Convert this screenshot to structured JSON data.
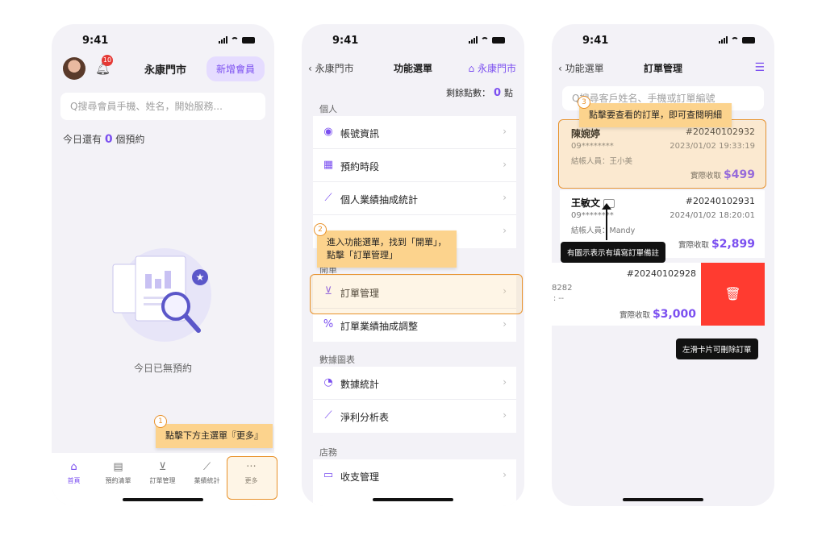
{
  "status": {
    "time": "9:41"
  },
  "screen1": {
    "avatar_icon": "user-avatar",
    "bell_icon": "bell-icon",
    "notification_count": "10",
    "store_name": "永康門市",
    "add_member_label": "新增會員",
    "search_placeholder": "Q搜尋會員手機、姓名，開始服務...",
    "today_prefix": "今日還有",
    "today_count": "0",
    "today_suffix": "個預約",
    "empty_text": "今日已無預約",
    "tabs": [
      {
        "label": "首頁",
        "icon": "home-icon"
      },
      {
        "label": "預約清單",
        "icon": "calendar-icon"
      },
      {
        "label": "訂單管理",
        "icon": "basket-icon"
      },
      {
        "label": "業績統計",
        "icon": "chart-icon"
      },
      {
        "label": "更多",
        "icon": "more-icon",
        "glyph": "···"
      }
    ],
    "callout_num": "1",
    "callout": "點擊下方主選單『更多』"
  },
  "screen2": {
    "back_label": "永康門市",
    "title": "功能選單",
    "right_label": "永康門市",
    "points_label": "剩餘點數：",
    "points_value": "0",
    "points_unit": "點",
    "section_personal": "個人",
    "item_account": "帳號資訊",
    "item_booking": "預約時段",
    "item_stats": "個人業績抽成統計",
    "section_order": "開單",
    "item_orders": "訂單管理",
    "item_commission": "訂單業績抽成調整",
    "section_data": "數據圖表",
    "item_data_stats": "數據統計",
    "item_profit": "淨利分析表",
    "section_store": "店務",
    "item_cashflow": "收支管理",
    "callout_num": "2",
    "callout_line1": "進入功能選單，找到「開單」，",
    "callout_line2": "點擊「訂單管理」"
  },
  "screen3": {
    "back_label": "功能選單",
    "title": "訂單管理",
    "search_placeholder": "Q搜尋客戶姓名、手機或訂單編號",
    "orders": [
      {
        "name": "陳婉婷",
        "no": "#20240102932",
        "phone": "09********",
        "date": "2023/01/02 19:33:19",
        "staff": "結帳人員：王小美",
        "amount_label": "實際收取",
        "amount": "$499"
      },
      {
        "name": "王敏文",
        "no": "#20240102931",
        "phone": "09********",
        "date": "2024/01/02 18:20:01",
        "staff": "結帳人員：Mandy",
        "amount_label": "實際收取",
        "amount": "$2,899"
      },
      {
        "name": "",
        "no": "#20240102928",
        "phone": "8282",
        "date": "",
        "staff": ": --",
        "amount_label": "實際收取",
        "amount": "$3,000"
      }
    ],
    "callout_num": "3",
    "callout": "點擊要查看的訂單，即可查閱明細",
    "tip_note": "有圖示表示有填寫訂單備註",
    "tip_delete": "左滑卡片可刪除訂單"
  }
}
